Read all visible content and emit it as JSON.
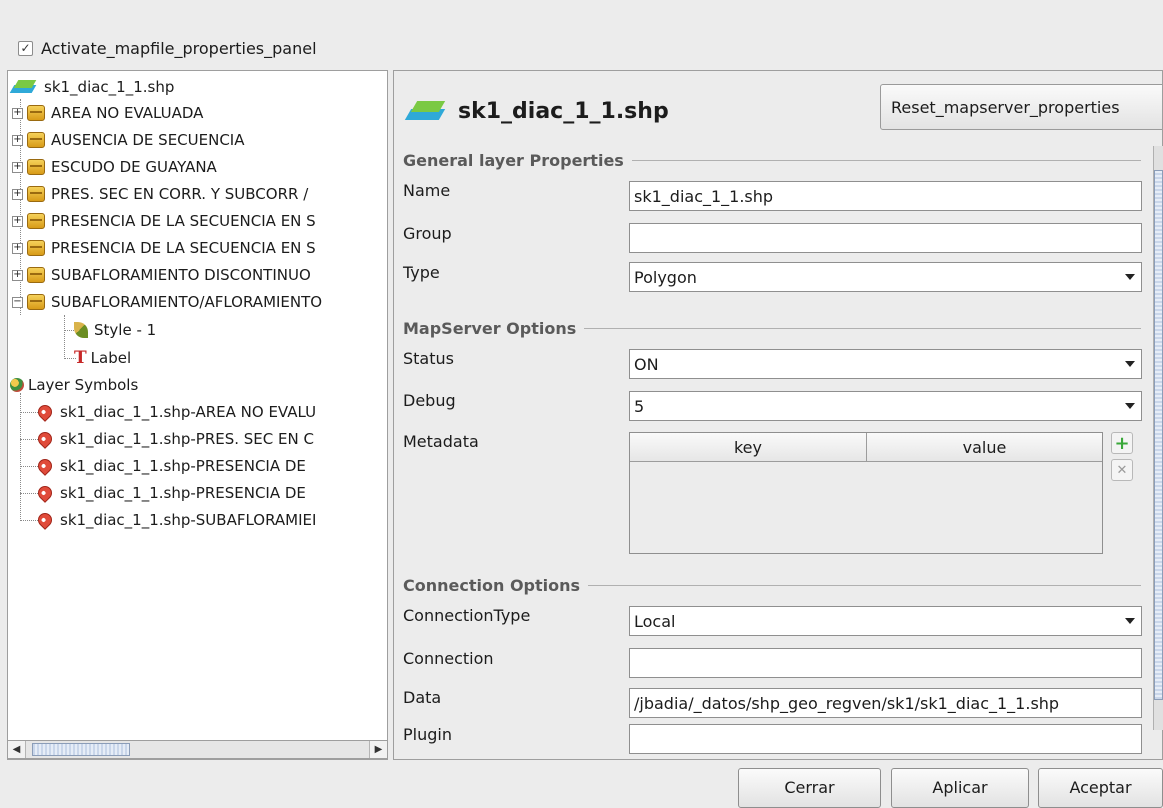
{
  "activate_checkbox": {
    "label": "Activate_mapfile_properties_panel",
    "checked": true
  },
  "tree": {
    "root": "sk1_diac_1_1.shp",
    "classes": [
      "AREA NO EVALUADA",
      "AUSENCIA DE SECUENCIA",
      "ESCUDO DE GUAYANA",
      "PRES. SEC EN CORR. Y SUBCORR /",
      "PRESENCIA DE LA SECUENCIA EN S",
      "PRESENCIA DE LA SECUENCIA EN S",
      "SUBAFLORAMIENTO DISCONTINUO",
      "SUBAFLORAMIENTO/AFLORAMIENTO"
    ],
    "expanded_children": [
      "Style - 1",
      "Label"
    ],
    "symbols_header": "Layer Symbols",
    "symbols": [
      "sk1_diac_1_1.shp-AREA NO EVALU",
      "sk1_diac_1_1.shp-PRES. SEC EN C",
      "sk1_diac_1_1.shp-PRESENCIA DE",
      "sk1_diac_1_1.shp-PRESENCIA DE",
      "sk1_diac_1_1.shp-SUBAFLORAMIEI"
    ]
  },
  "panel": {
    "title": "sk1_diac_1_1.shp",
    "reset_button": "Reset_mapserver_properties",
    "sections": {
      "general": "General layer Properties",
      "mapserver": "MapServer Options",
      "connection": "Connection Options"
    },
    "labels": {
      "name": "Name",
      "group": "Group",
      "type": "Type",
      "status": "Status",
      "debug": "Debug",
      "metadata": "Metadata",
      "connection_type": "ConnectionType",
      "connection": "Connection",
      "data": "Data",
      "plugin": "Plugin"
    },
    "values": {
      "name": "sk1_diac_1_1.shp",
      "group": "",
      "type": "Polygon",
      "status": "ON",
      "debug": "5",
      "connection_type": "Local",
      "connection": "",
      "data": "/jbadia/_datos/shp_geo_regven/sk1/sk1_diac_1_1.shp",
      "plugin": ""
    },
    "metadata_columns": [
      "key",
      "value"
    ]
  },
  "buttons": {
    "close": "Cerrar",
    "apply": "Aplicar",
    "accept": "Aceptar"
  },
  "colors": {
    "add_icon": "#3aa83a",
    "remove_icon": "#9a9a9a",
    "pin": "#e04b3a"
  }
}
